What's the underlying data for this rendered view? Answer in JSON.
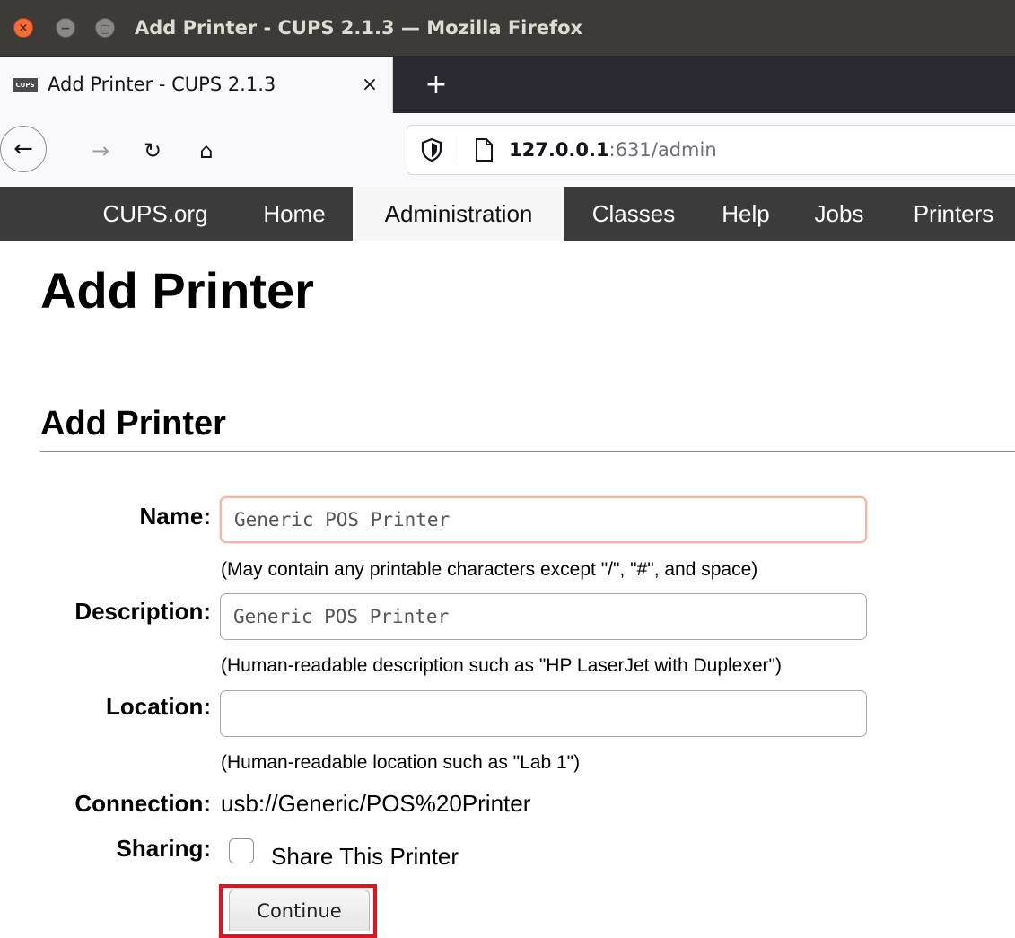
{
  "window": {
    "title": "Add Printer - CUPS 2.1.3 — Mozilla Firefox",
    "controls": {
      "close": "×",
      "minimize": "−",
      "maximize": "□"
    }
  },
  "tabs": [
    {
      "title": "Add Printer - CUPS 2.1.3",
      "favicon_text": "CUPS",
      "close": "×",
      "active": true
    }
  ],
  "new_tab_label": "+",
  "toolbar": {
    "back": "←",
    "forward": "→",
    "reload": "↻",
    "home": "⌂",
    "url_host": "127.0.0.1",
    "url_rest": ":631/admin"
  },
  "cups_nav": {
    "items": [
      "CUPS.org",
      "Home",
      "Administration",
      "Classes",
      "Help",
      "Jobs",
      "Printers"
    ],
    "active": "Administration"
  },
  "page": {
    "title": "Add Printer",
    "section_title": "Add Printer"
  },
  "form": {
    "name": {
      "label": "Name:",
      "value": "Generic_POS_Printer",
      "hint": "(May contain any printable characters except \"/\", \"#\", and space)"
    },
    "description": {
      "label": "Description:",
      "value": "Generic POS Printer",
      "hint": "(Human-readable description such as \"HP LaserJet with Duplexer\")"
    },
    "location": {
      "label": "Location:",
      "value": "",
      "hint": "(Human-readable location such as \"Lab 1\")"
    },
    "connection": {
      "label": "Connection:",
      "value": "usb://Generic/POS%20Printer"
    },
    "sharing": {
      "label": "Sharing:",
      "checkbox_label": "Share This Printer",
      "checked": false
    },
    "continue_label": "Continue"
  },
  "colors": {
    "titlebar": "#3c3b37",
    "tabstrip": "#2b2a33",
    "cups_nav": "#3b3b3b",
    "highlight": "#e0141e",
    "close_button": "#f46d3a"
  }
}
